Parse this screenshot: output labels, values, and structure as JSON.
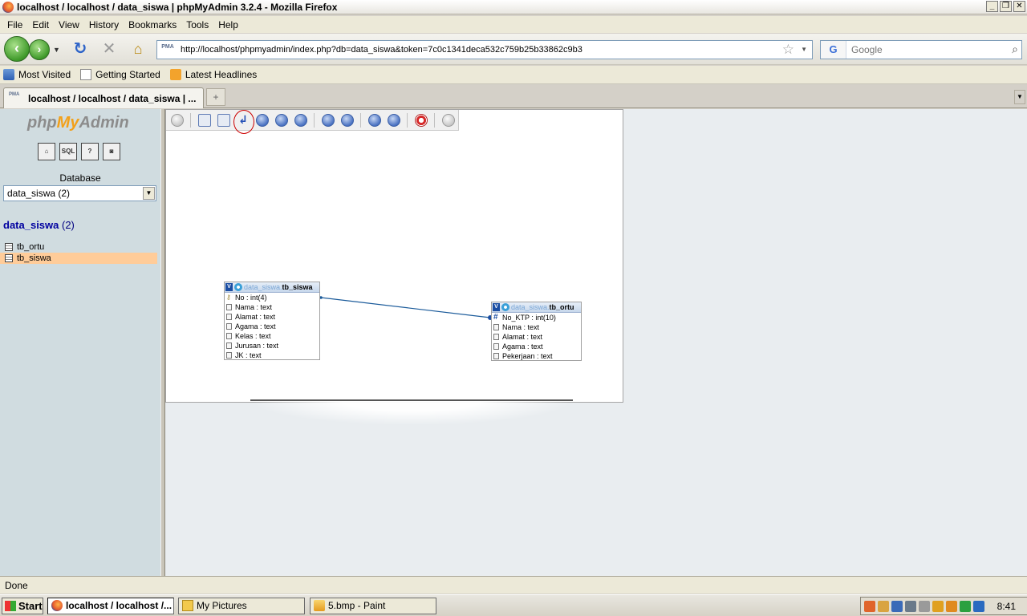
{
  "window": {
    "title": "localhost / localhost / data_siswa | phpMyAdmin 3.2.4 - Mozilla Firefox",
    "buttons": [
      "_",
      "❐",
      "✕"
    ]
  },
  "menu": [
    "File",
    "Edit",
    "View",
    "History",
    "Bookmarks",
    "Tools",
    "Help"
  ],
  "nav": {
    "url": "http://localhost/phpmyadmin/index.php?db=data_siswa&token=7c0c1341deca532c759b25b33862c9b3",
    "search_placeholder": "Google",
    "pma_badge": "PMA"
  },
  "bookmarks": [
    "Most Visited",
    "Getting Started",
    "Latest Headlines"
  ],
  "tab": {
    "label": "localhost / localhost / data_siswa | ...",
    "new_tab": "+"
  },
  "sidebar": {
    "logo": {
      "php": "php",
      "my": "My",
      "admin": "Admin"
    },
    "icons": [
      "home-icon",
      "sql-icon",
      "query-icon",
      "docs-icon"
    ],
    "icon_labels": [
      "⌂",
      "SQL",
      "?",
      "◙"
    ],
    "database_label": "Database",
    "database_select": "data_siswa (2)",
    "db_heading": "data_siswa",
    "db_count": "(2)",
    "tables": [
      {
        "name": "tb_ortu",
        "selected": false
      },
      {
        "name": "tb_siswa",
        "selected": true
      }
    ]
  },
  "designer": {
    "tables": [
      {
        "db": "data_siswa.",
        "name": "tb_siswa",
        "rows": [
          "No : int(4)",
          "Nama : text",
          "Alamat : text",
          "Agama : text",
          "Kelas : text",
          "Jurusan : text",
          "JK : text"
        ]
      },
      {
        "db": "data_siswa.",
        "name": "tb_ortu",
        "rows": [
          "No_KTP : int(10)",
          "Nama : text",
          "Alamat : text",
          "Agama : text",
          "Pekerjaan : text"
        ]
      }
    ]
  },
  "status": "Done",
  "taskbar": {
    "start": "Start",
    "tasks": [
      "localhost / localhost /...",
      "My Pictures",
      "5.bmp - Paint"
    ],
    "clock": "8:41"
  }
}
